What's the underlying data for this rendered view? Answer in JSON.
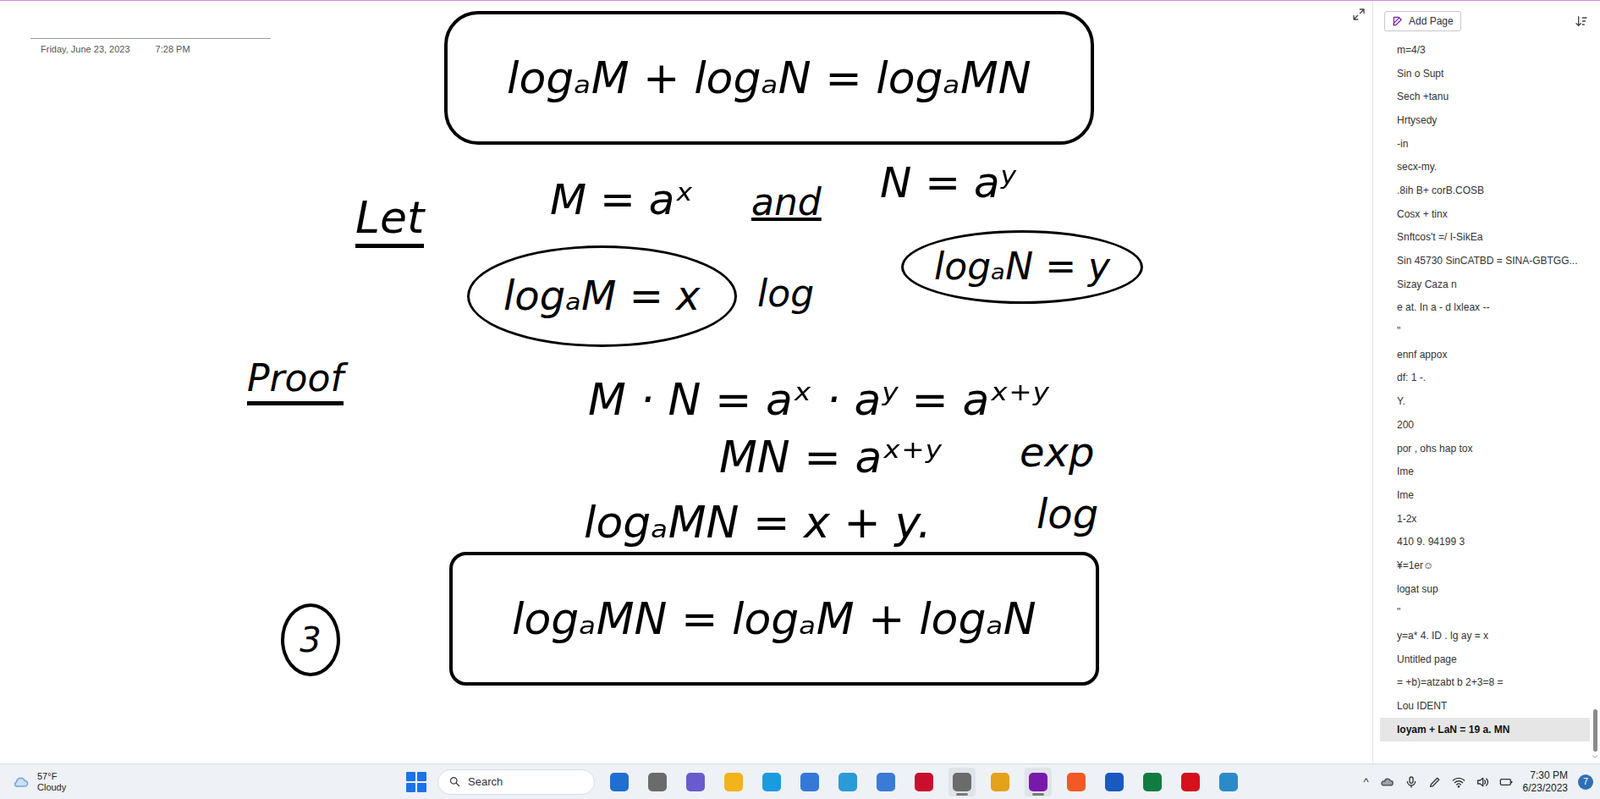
{
  "page": {
    "date": "Friday, June 23, 2023",
    "time": "7:28 PM"
  },
  "ink": [
    {
      "text": "logₐM + logₐN = logₐMN",
      "kind": "boxed"
    },
    {
      "text": "Let",
      "kind": "underlined"
    },
    {
      "text": "M = aˣ",
      "kind": "plain"
    },
    {
      "text": "and",
      "kind": "plain"
    },
    {
      "text": "N = aʸ",
      "kind": "plain"
    },
    {
      "text": "logₐM = x",
      "kind": "ellipse"
    },
    {
      "text": "log",
      "kind": "plain"
    },
    {
      "text": "logₐN = y",
      "kind": "ellipse"
    },
    {
      "text": "Proof",
      "kind": "underlined"
    },
    {
      "text": "M · N = aˣ · aʸ = aˣ⁺ʸ",
      "kind": "plain"
    },
    {
      "text": "MN = aˣ⁺ʸ",
      "kind": "plain"
    },
    {
      "text": "exp",
      "kind": "plain"
    },
    {
      "text": "logₐMN = x + y.",
      "kind": "plain"
    },
    {
      "text": "log",
      "kind": "plain"
    },
    {
      "text": "logₐMN = logₐM + logₐN",
      "kind": "boxed"
    },
    {
      "text": "3",
      "kind": "circle"
    }
  ],
  "toolbar": {
    "add_page": "Add Page"
  },
  "pages": [
    {
      "title": "m=4/3",
      "selected": false
    },
    {
      "title": "Sin o Supt",
      "selected": false
    },
    {
      "title": "Sech +tanu",
      "selected": false
    },
    {
      "title": "Hrtysedy",
      "selected": false
    },
    {
      "title": "-in",
      "selected": false
    },
    {
      "title": "secx-my.",
      "selected": false
    },
    {
      "title": ".8ih B+ corB.COSB",
      "selected": false
    },
    {
      "title": "Cosx + tinx",
      "selected": false
    },
    {
      "title": "Snftcos't =/ I-SikEa",
      "selected": false
    },
    {
      "title": "Sin 45730 SinCATBD = SINA-GBTGG...",
      "selected": false
    },
    {
      "title": "Sizay Caza n",
      "selected": false
    },
    {
      "title": "e at. In a - d lxleax --",
      "selected": false
    },
    {
      "title": "\"",
      "selected": false
    },
    {
      "title": "ennf appox",
      "selected": false
    },
    {
      "title": "df: 1 -.",
      "selected": false
    },
    {
      "title": "Y.",
      "selected": false
    },
    {
      "title": "200",
      "selected": false
    },
    {
      "title": "por , ohs hap tox",
      "selected": false
    },
    {
      "title": "Ime",
      "selected": false
    },
    {
      "title": "Ime",
      "selected": false
    },
    {
      "title": "1-2x",
      "selected": false
    },
    {
      "title": "410 9. 94199 3",
      "selected": false
    },
    {
      "title": "¥=1er☺",
      "selected": false
    },
    {
      "title": "logat sup",
      "selected": false
    },
    {
      "title": "\"",
      "selected": false
    },
    {
      "title": "y=a* 4. ID . lg ay = x",
      "selected": false
    },
    {
      "title": "Untitled page",
      "selected": false
    },
    {
      "title": "= +b)=atzabt b 2+3=8 =",
      "selected": false
    },
    {
      "title": "Lou IDENT",
      "selected": false
    },
    {
      "title": "loyam + LaN = 19 a. MN",
      "selected": true
    }
  ],
  "taskbar": {
    "weather": {
      "temp": "57°F",
      "condition": "Cloudy"
    },
    "search": "Search",
    "apps": [
      {
        "color": "#1f6fd1",
        "active": false
      },
      {
        "color": "#6b6b6b",
        "active": false
      },
      {
        "color": "#6a5acd",
        "active": false
      },
      {
        "color": "#f2b31b",
        "active": false
      },
      {
        "color": "#1a9be0",
        "active": false
      },
      {
        "color": "#3478d8",
        "active": false
      },
      {
        "color": "#2b9bd8",
        "active": false
      },
      {
        "color": "#3a7bd5",
        "active": false
      },
      {
        "color": "#c8102e",
        "active": false
      },
      {
        "color": "#6b6b6b",
        "active": true
      },
      {
        "color": "#e3a21a",
        "active": false
      },
      {
        "color": "#7719aa",
        "active": true
      },
      {
        "color": "#f15a24",
        "active": false
      },
      {
        "color": "#185abd",
        "active": false
      },
      {
        "color": "#107c41",
        "active": false
      },
      {
        "color": "#d4111d",
        "active": false
      },
      {
        "color": "#2c8bc7",
        "active": false
      }
    ],
    "tray_chevron": "^",
    "clock": {
      "time": "7:30 PM",
      "date": "6/23/2023"
    },
    "notifications": "7"
  }
}
